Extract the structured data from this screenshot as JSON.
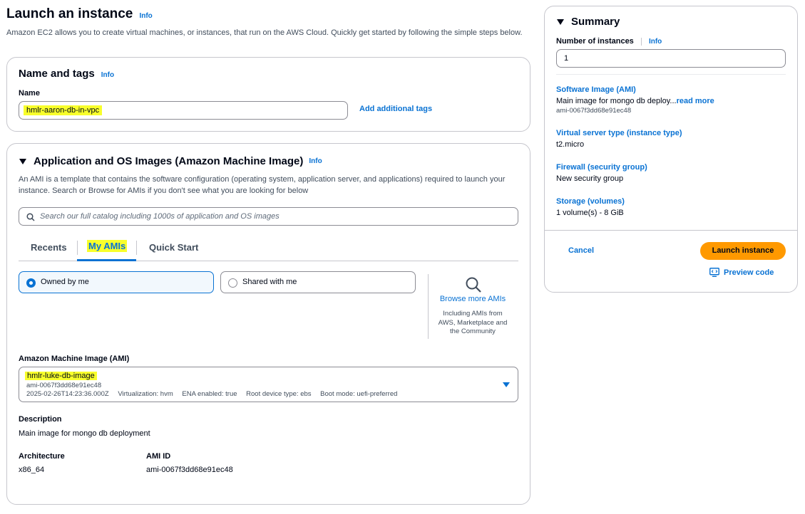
{
  "header": {
    "title": "Launch an instance",
    "info": "Info",
    "description": "Amazon EC2 allows you to create virtual machines, or instances, that run on the AWS Cloud. Quickly get started by following the simple steps below."
  },
  "name_tags": {
    "title": "Name and tags",
    "info": "Info",
    "name_label": "Name",
    "name_value": "hmlr-aaron-db-in-vpc",
    "add_tags": "Add additional tags"
  },
  "ami_section": {
    "title": "Application and OS Images (Amazon Machine Image)",
    "info": "Info",
    "description": "An AMI is a template that contains the software configuration (operating system, application server, and applications) required to launch your instance. Search or Browse for AMIs if you don't see what you are looking for below",
    "search_placeholder": "Search our full catalog including 1000s of application and OS images",
    "tabs": [
      "Recents",
      "My AMIs",
      "Quick Start"
    ],
    "active_tab": "My AMIs",
    "owned_by_me": "Owned by me",
    "shared_with_me": "Shared with me",
    "browse_more": "Browse more AMIs",
    "browse_sub": "Including AMIs from AWS, Marketplace and the Community",
    "ami_label": "Amazon Machine Image (AMI)",
    "ami_name": "hmlr-luke-db-image",
    "ami_id_line": "ami-0067f3dd68e91ec48",
    "ami_meta": [
      "2025-02-26T14:23:36.000Z",
      "Virtualization: hvm",
      "ENA enabled: true",
      "Root device type: ebs",
      "Boot mode: uefi-preferred"
    ],
    "description_label": "Description",
    "description_value": "Main image for mongo db deployment",
    "architecture_label": "Architecture",
    "architecture_value": "x86_64",
    "ami_id_label": "AMI ID",
    "ami_id_value": "ami-0067f3dd68e91ec48"
  },
  "summary": {
    "title": "Summary",
    "num_label": "Number of instances",
    "info": "Info",
    "num_value": "1",
    "software_label": "Software Image (AMI)",
    "software_value": "Main image for mongo db deploy...",
    "read_more": "read more",
    "software_id": "ami-0067f3dd68e91ec48",
    "server_label": "Virtual server type (instance type)",
    "server_value": "t2.micro",
    "firewall_label": "Firewall (security group)",
    "firewall_value": "New security group",
    "storage_label": "Storage (volumes)",
    "storage_value": "1 volume(s) - 8 GiB",
    "cancel": "Cancel",
    "launch": "Launch instance",
    "preview": "Preview code"
  },
  "colors": {
    "accent": "#0972d3",
    "launch": "#ff9900",
    "highlight": "#f8ff2b",
    "selected_bg": "#f2f8fd"
  }
}
